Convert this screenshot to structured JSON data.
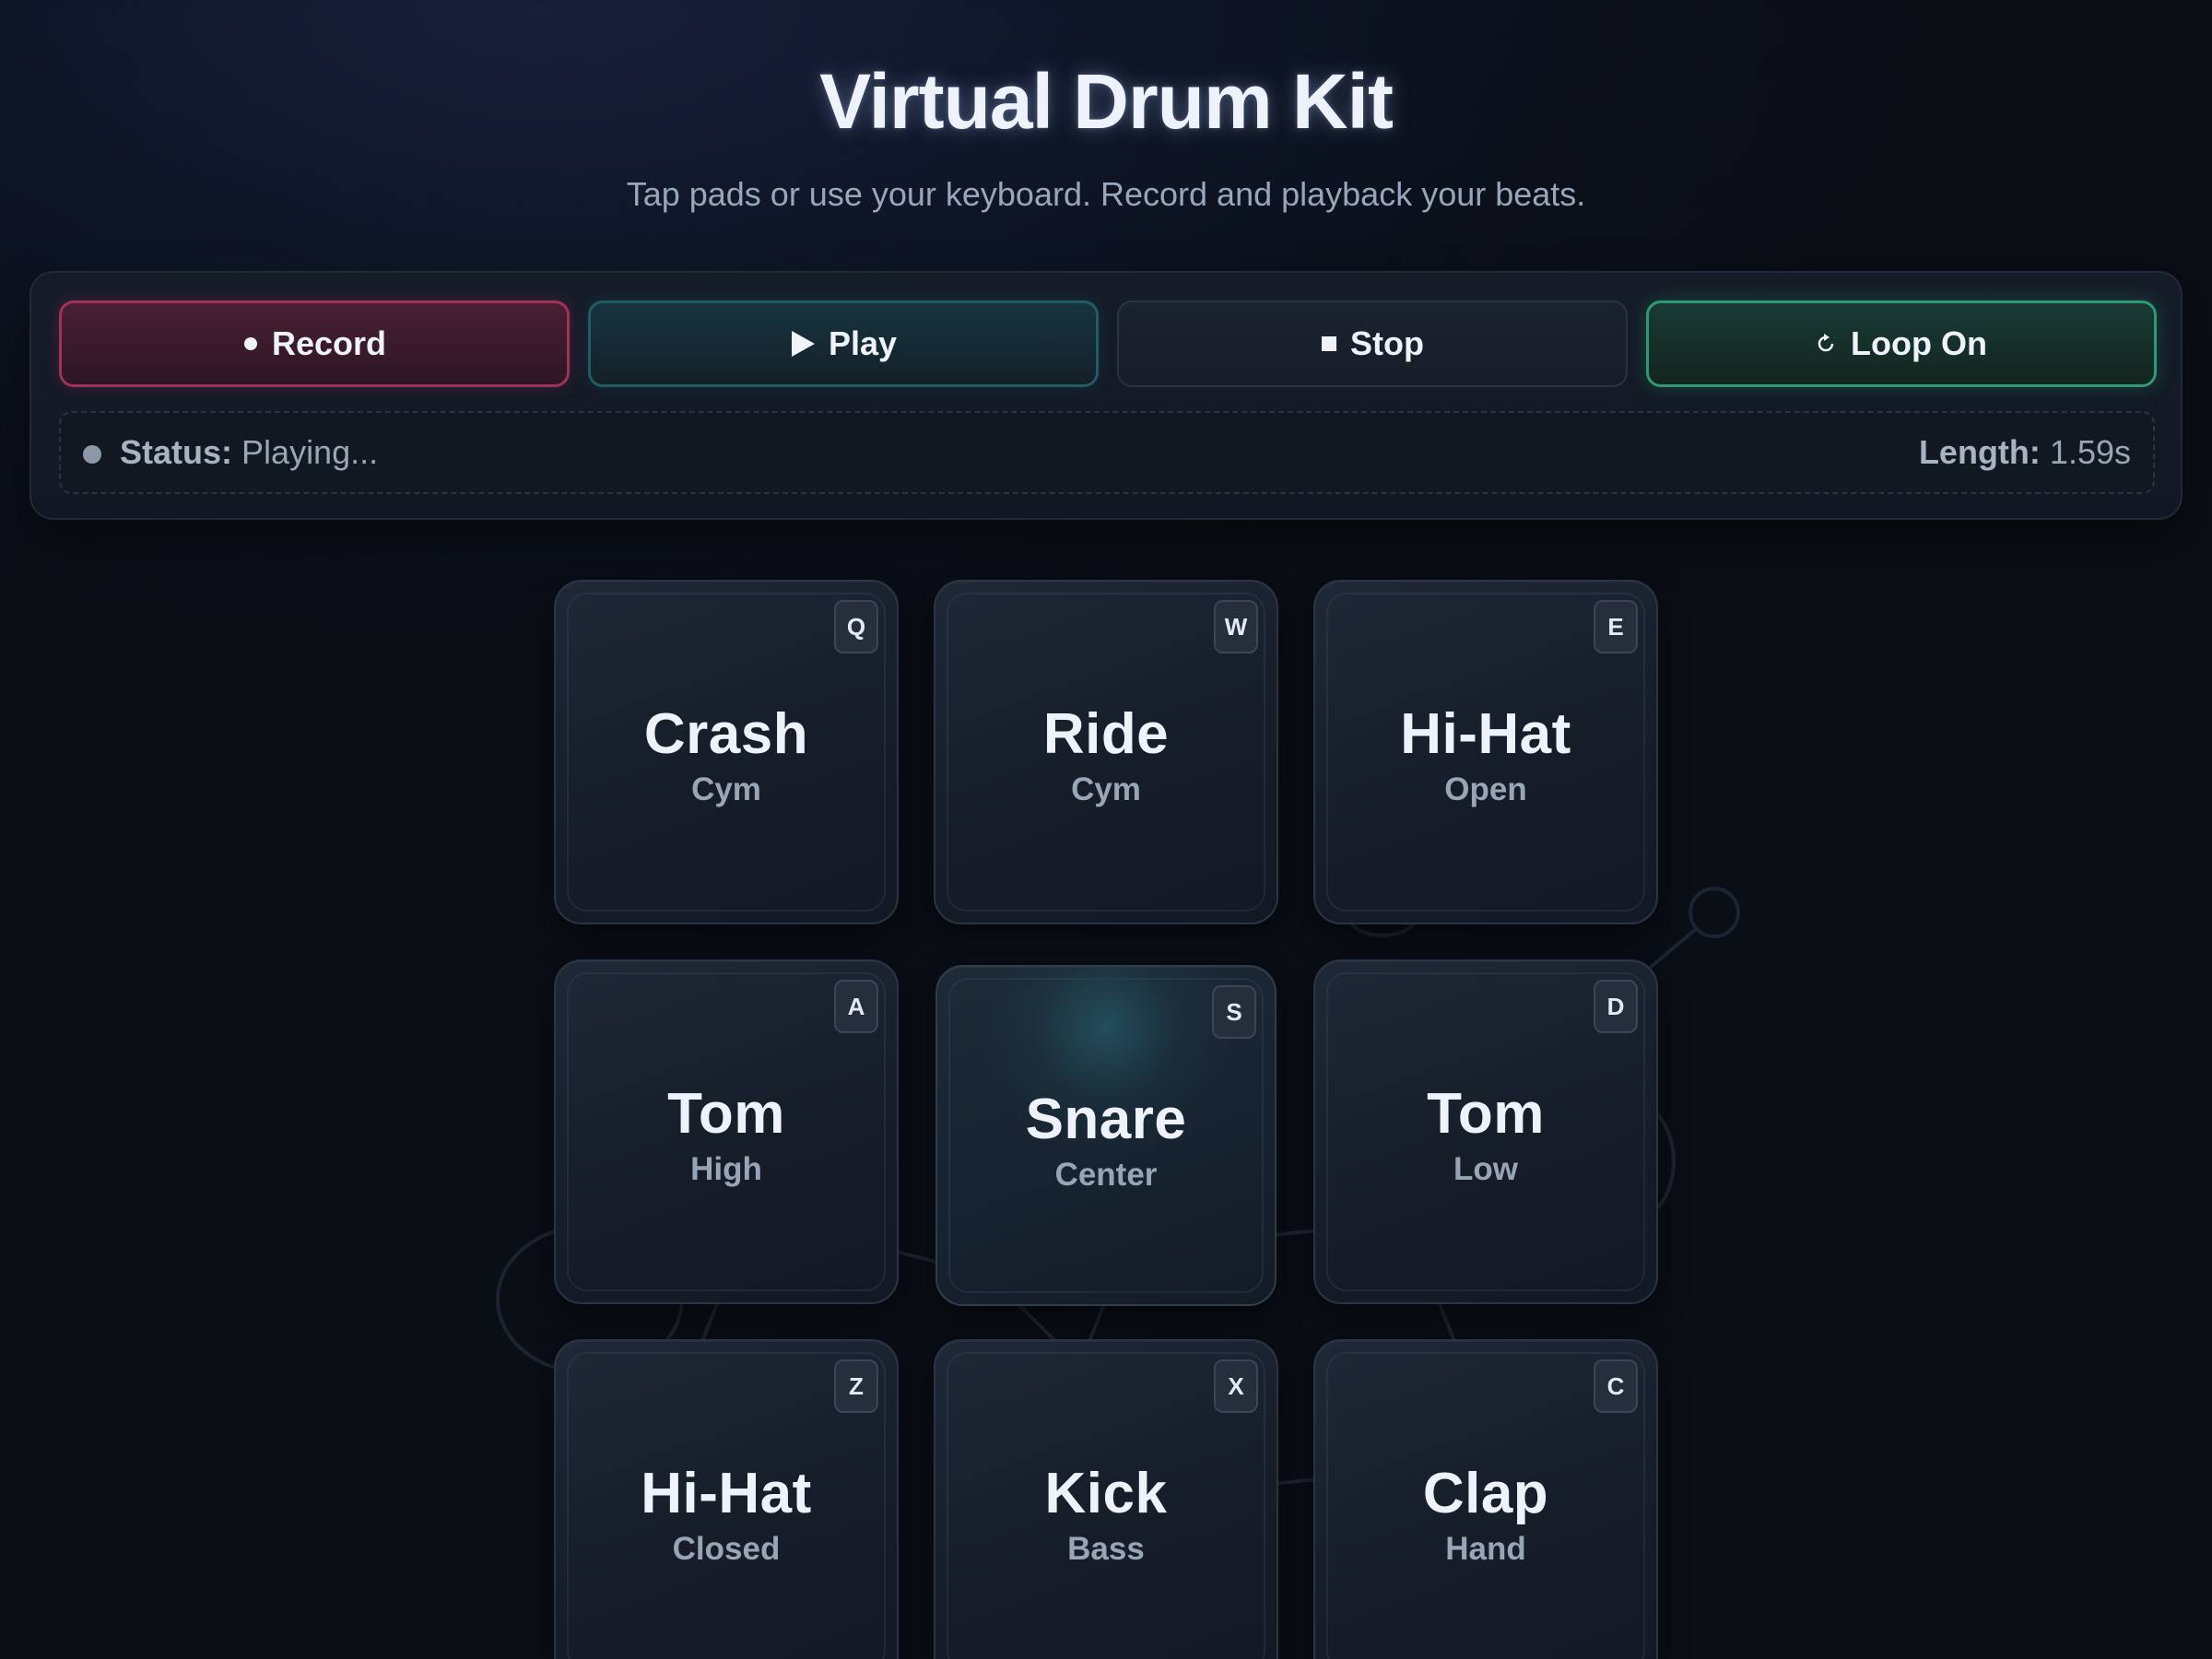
{
  "header": {
    "title": "Virtual Drum Kit",
    "subtitle": "Tap pads or use your keyboard. Record and playback your beats."
  },
  "controls": {
    "record_label": "Record",
    "play_label": "Play",
    "stop_label": "Stop",
    "loop_label": "Loop On"
  },
  "status": {
    "status_label": "Status:",
    "status_value": "Playing...",
    "length_label": "Length:",
    "length_value": "1.59s"
  },
  "pads": [
    {
      "name": "Crash",
      "sub": "Cym",
      "key": "Q"
    },
    {
      "name": "Ride",
      "sub": "Cym",
      "key": "W"
    },
    {
      "name": "Hi-Hat",
      "sub": "Open",
      "key": "E"
    },
    {
      "name": "Tom",
      "sub": "High",
      "key": "A"
    },
    {
      "name": "Snare",
      "sub": "Center",
      "key": "S",
      "active": true
    },
    {
      "name": "Tom",
      "sub": "Low",
      "key": "D"
    },
    {
      "name": "Hi-Hat",
      "sub": "Closed",
      "key": "Z"
    },
    {
      "name": "Kick",
      "sub": "Bass",
      "key": "X"
    },
    {
      "name": "Clap",
      "sub": "Hand",
      "key": "C"
    }
  ],
  "colors": {
    "record_accent": "#a0325a",
    "play_accent": "#1f5c63",
    "loop_accent": "#2e9a73",
    "active_pad_glow": "#286e78"
  }
}
